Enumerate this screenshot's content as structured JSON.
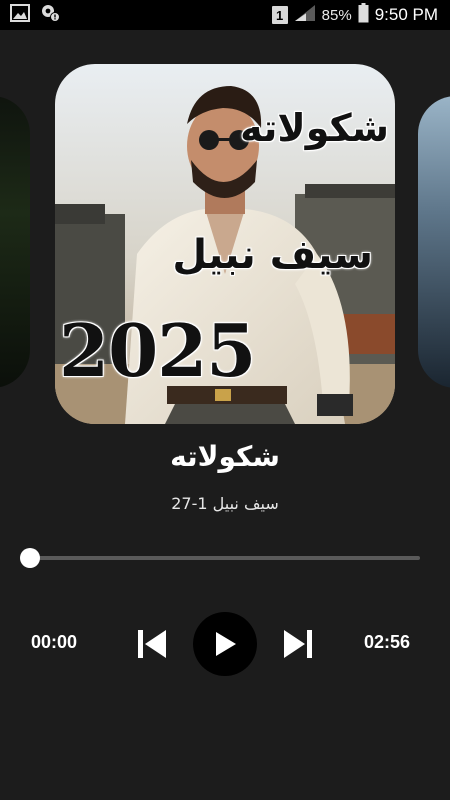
{
  "status_bar": {
    "icons": [
      "image-icon",
      "location-notify-icon",
      "sim-badge-icon",
      "signal-icon",
      "battery-icon"
    ],
    "sim_badge": "1",
    "battery": "85%",
    "time": "9:50 PM"
  },
  "album": {
    "cover_title": "شكولاته",
    "cover_artist": "سيف نبيل",
    "cover_year": "2025"
  },
  "song": {
    "title": "شكولاته",
    "artist": "سيف نبيل 1-27"
  },
  "player": {
    "elapsed": "00:00",
    "total": "02:56",
    "progress": 0
  },
  "colors": {
    "background": "#1c1c1c",
    "status_bar": "#000000",
    "accent": "#ffffff",
    "track": "#5a5a5a"
  }
}
